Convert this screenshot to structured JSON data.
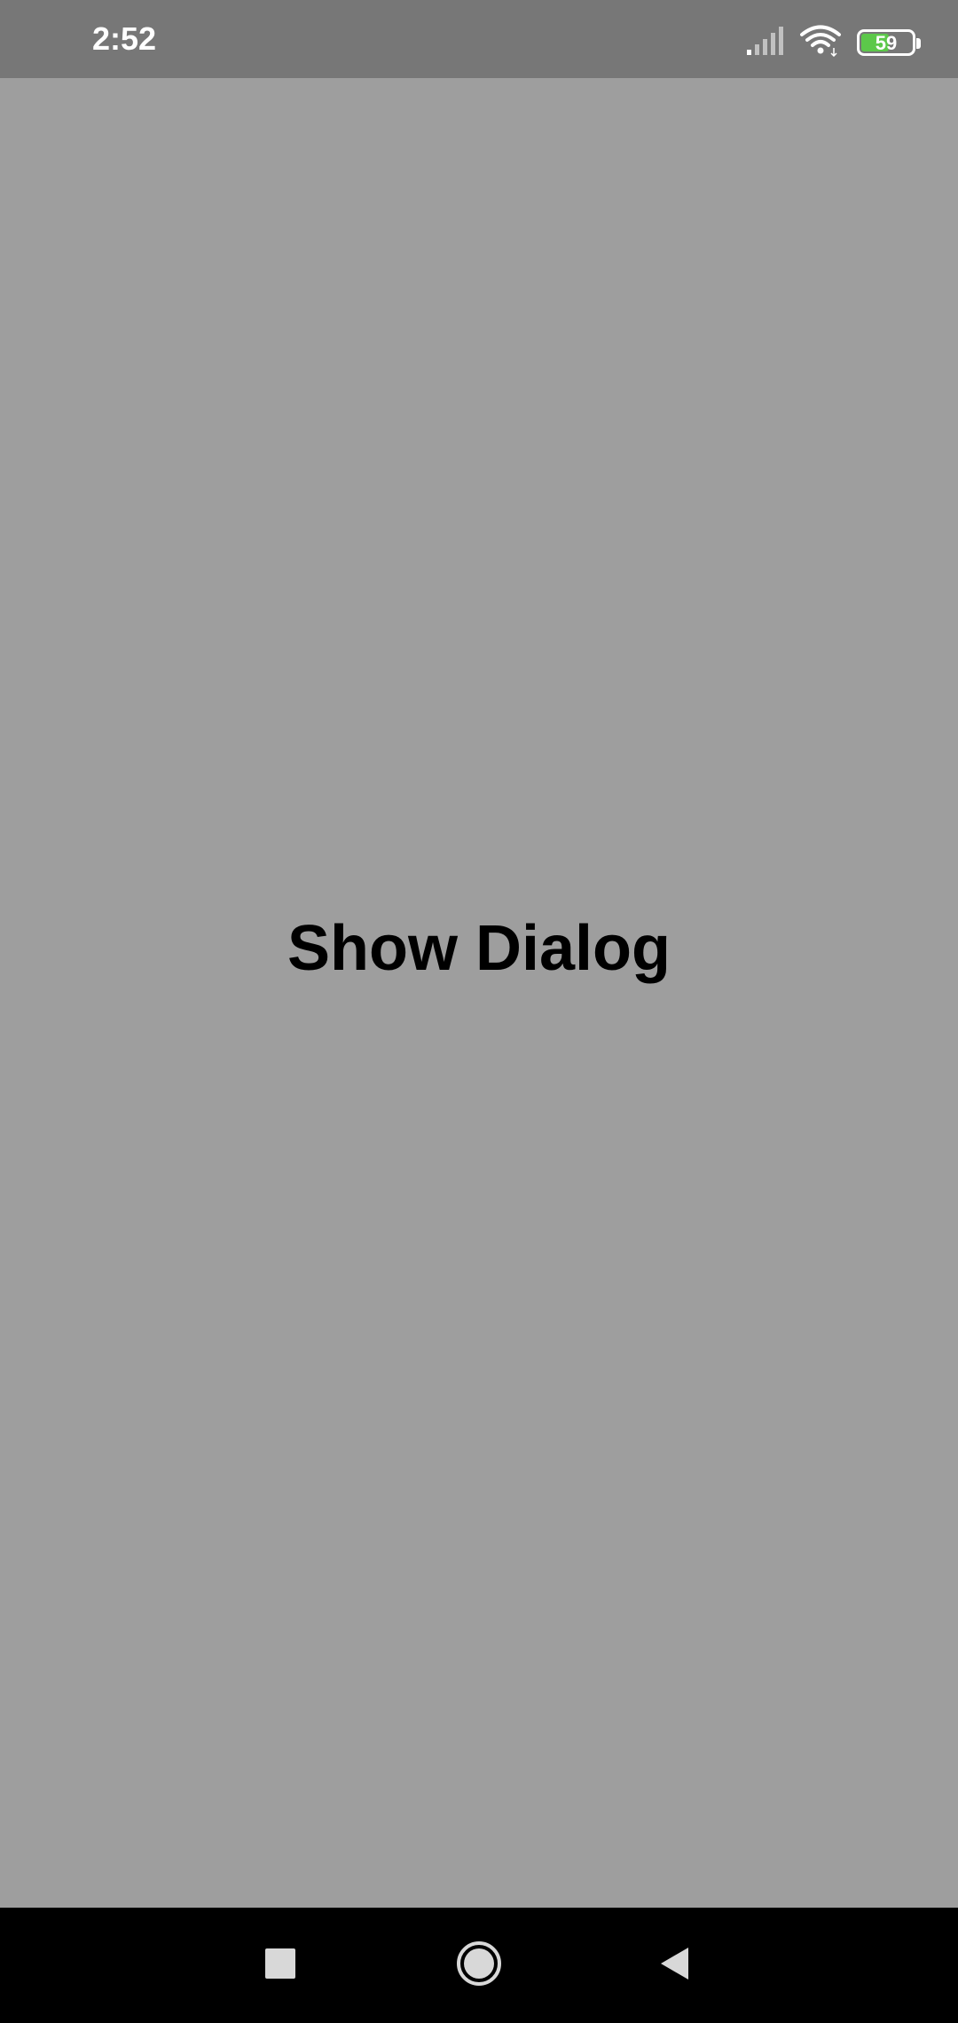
{
  "status_bar": {
    "time": "2:52",
    "battery_level": "59",
    "battery_percent": 59,
    "signal_icon": "cellular-signal-icon",
    "wifi_icon": "wifi-icon",
    "battery_color": "#5cc84a"
  },
  "main": {
    "show_dialog_label": "Show Dialog",
    "background_color": "#9e9e9e"
  },
  "nav_bar": {
    "recents_icon": "square-recents-icon",
    "home_icon": "circle-home-icon",
    "back_icon": "triangle-back-icon"
  }
}
